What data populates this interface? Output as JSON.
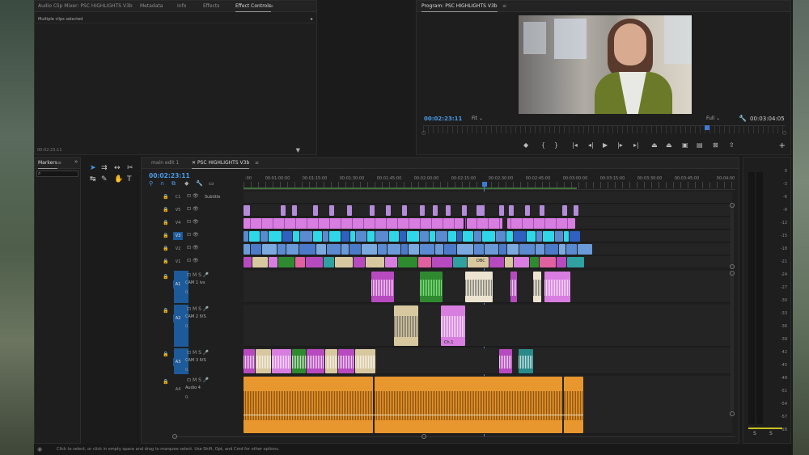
{
  "source_panel": {
    "tabs": [
      "Audio Clip Mixer: PSC HIGHLIGHTS V3b",
      "Metadata",
      "Info",
      "Effects",
      "Effect Controls"
    ],
    "active_tab": "Effect Controls",
    "subheader": "Multiple clips selected",
    "timecode": "00:02:23:11"
  },
  "program_panel": {
    "title": "Program: PSC HIGHLIGHTS V3b",
    "timecode": "00:02:23:11",
    "fit": "Fit",
    "quality": "Full",
    "duration": "00:03:04:05"
  },
  "markers_panel": {
    "title": "Markers"
  },
  "timeline": {
    "tabs": [
      "main edit 1",
      "PSC HIGHLIGHTS V3b"
    ],
    "timecode": "00:02:23:11",
    "ruler_labels": [
      ":00",
      "00:01:00:00",
      "00:01:15:00",
      "00:01:30:00",
      "00:01:45:00",
      "00:02:00:00",
      "00:02:15:00",
      "00:02:30:00",
      "00:02:45:00",
      "00:03:00:00",
      "00:03:15:00",
      "00:03:30:00",
      "00:03:45:00",
      "00:04:00"
    ],
    "video_tracks": [
      {
        "id": "C1",
        "label": "Subtitle"
      },
      {
        "id": "V5",
        "label": ""
      },
      {
        "id": "V4",
        "label": ""
      },
      {
        "id": "V3",
        "label": ""
      },
      {
        "id": "V2",
        "label": ""
      },
      {
        "id": "V1",
        "label": ""
      }
    ],
    "audio_tracks": [
      {
        "id": "A1",
        "name": "CAM 1 ivs",
        "vol": "0."
      },
      {
        "id": "A2",
        "name": "CAM 2 IVS",
        "vol": "0."
      },
      {
        "id": "A3",
        "name": "CAM 3 IVS",
        "vol": "0."
      },
      {
        "id": "A4",
        "name": "Audio 4",
        "vol": "0."
      }
    ],
    "clip_labels": {
      "v1_dbc": "DBC",
      "a2_clip": "Ch.1"
    }
  },
  "meters": {
    "scale": [
      "0",
      "-3",
      "-6",
      "-9",
      "-12",
      "-15",
      "-18",
      "-21",
      "-24",
      "-27",
      "-30",
      "-33",
      "-36",
      "-39",
      "-42",
      "-45",
      "-48",
      "-51",
      "-54",
      "-57",
      "dB"
    ],
    "solo_labels": [
      "S",
      "S"
    ]
  },
  "status_bar": {
    "text": "Click to select, or click in empty space and drag to marquee select. Use Shift, Opt, and Cmd for other options."
  },
  "colors": {
    "accent_blue": "#4a9be8",
    "clip_pink": "#d77ee0",
    "clip_cyan": "#2fd8e8",
    "clip_blue": "#5a8ad0",
    "clip_magenta": "#b84ac0",
    "clip_green": "#2f8a2f",
    "clip_orange": "#e8962e",
    "clip_tan": "#d8c8a0"
  }
}
